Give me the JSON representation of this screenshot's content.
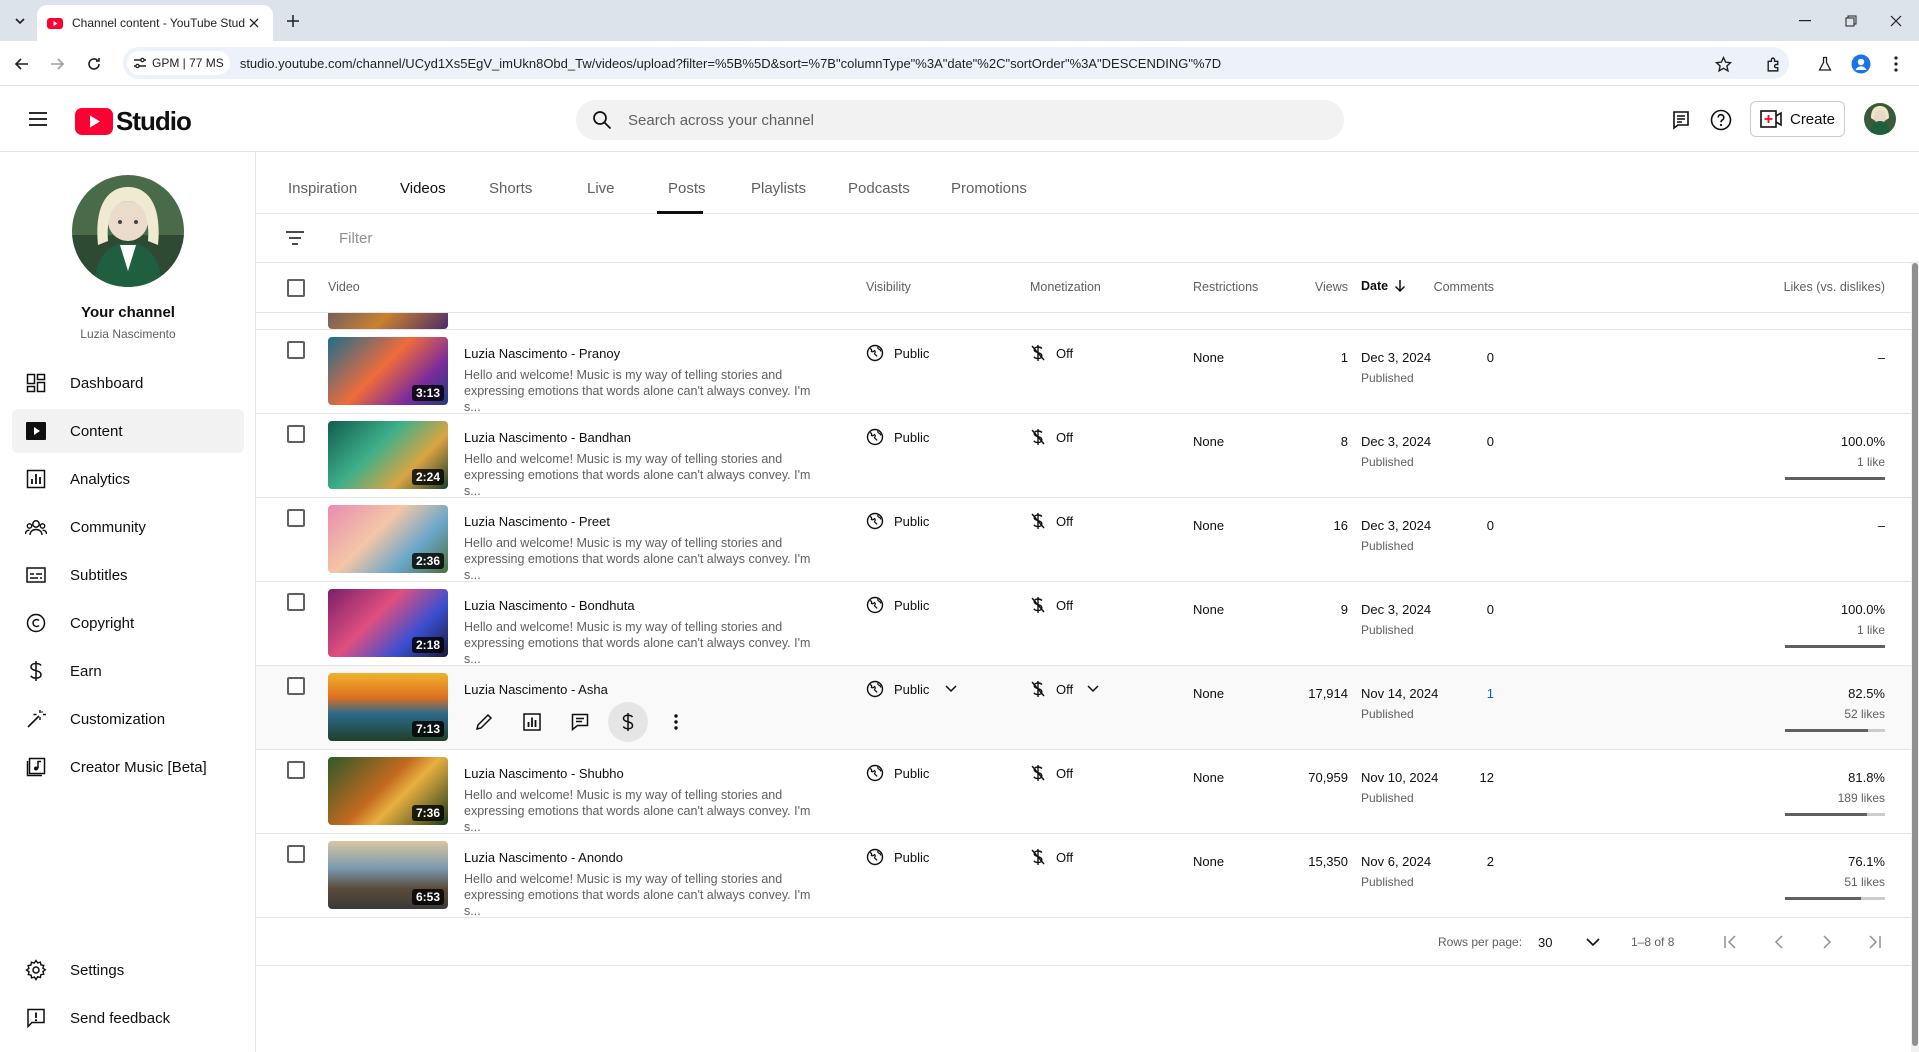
{
  "browser": {
    "tab_title": "Channel content - YouTube Studio",
    "gpm_label": "GPM | 77 MS",
    "url": "studio.youtube.com/channel/UCyd1Xs5EgV_imUkn8Obd_Tw/videos/upload?filter=%5B%5D&sort=%7B\"columnType\"%3A\"date\"%2C\"sortOrder\"%3A\"DESCENDING\"%7D"
  },
  "header": {
    "logo_text": "Studio",
    "search_placeholder": "Search across your channel",
    "create_label": "Create"
  },
  "channel": {
    "title": "Your channel",
    "name": "Luzia Nascimento"
  },
  "sidebar": {
    "items": [
      {
        "label": "Dashboard",
        "icon": "dashboard-icon"
      },
      {
        "label": "Content",
        "icon": "content-icon"
      },
      {
        "label": "Analytics",
        "icon": "analytics-icon"
      },
      {
        "label": "Community",
        "icon": "community-icon"
      },
      {
        "label": "Subtitles",
        "icon": "subtitles-icon"
      },
      {
        "label": "Copyright",
        "icon": "copyright-icon"
      },
      {
        "label": "Earn",
        "icon": "earn-icon"
      },
      {
        "label": "Customization",
        "icon": "customization-icon"
      },
      {
        "label": "Creator Music [Beta]",
        "icon": "creator-music-icon"
      }
    ],
    "settings_label": "Settings",
    "feedback_label": "Send feedback"
  },
  "tabs": [
    "Inspiration",
    "Videos",
    "Shorts",
    "Live",
    "Posts",
    "Playlists",
    "Podcasts",
    "Promotions"
  ],
  "active_tab": "Videos",
  "filter_placeholder": "Filter",
  "columns": {
    "video": "Video",
    "visibility": "Visibility",
    "monetization": "Monetization",
    "restrictions": "Restrictions",
    "date": "Date",
    "views": "Views",
    "comments": "Comments",
    "likes": "Likes (vs. dislikes)"
  },
  "rows": [
    {
      "title": "Luzia Nascimento - Pranoy",
      "duration": "3:13",
      "desc": "Hello and welcome! Music is my way of telling stories and expressing emotions that words alone can't always convey. I'm s...",
      "visibility": "Public",
      "monetization": "Off",
      "restrictions": "None",
      "date": "Dec 3, 2024",
      "status": "Published",
      "views": "1",
      "comments": "0",
      "likes_pct": "–",
      "likes_count": "",
      "likes_ratio": null
    },
    {
      "title": "Luzia Nascimento - Bandhan",
      "duration": "2:24",
      "desc": "Hello and welcome! Music is my way of telling stories and expressing emotions that words alone can't always convey. I'm s...",
      "visibility": "Public",
      "monetization": "Off",
      "restrictions": "None",
      "date": "Dec 3, 2024",
      "status": "Published",
      "views": "8",
      "comments": "0",
      "likes_pct": "100.0%",
      "likes_count": "1 like",
      "likes_ratio": 1.0
    },
    {
      "title": "Luzia Nascimento - Preet",
      "duration": "2:36",
      "desc": "Hello and welcome! Music is my way of telling stories and expressing emotions that words alone can't always convey. I'm s...",
      "visibility": "Public",
      "monetization": "Off",
      "restrictions": "None",
      "date": "Dec 3, 2024",
      "status": "Published",
      "views": "16",
      "comments": "0",
      "likes_pct": "–",
      "likes_count": "",
      "likes_ratio": null
    },
    {
      "title": "Luzia Nascimento - Bondhuta",
      "duration": "2:18",
      "desc": "Hello and welcome! Music is my way of telling stories and expressing emotions that words alone can't always convey. I'm s...",
      "visibility": "Public",
      "monetization": "Off",
      "restrictions": "None",
      "date": "Dec 3, 2024",
      "status": "Published",
      "views": "9",
      "comments": "0",
      "likes_pct": "100.0%",
      "likes_count": "1 like",
      "likes_ratio": 1.0
    },
    {
      "title": "Luzia Nascimento - Asha",
      "duration": "7:13",
      "desc": "",
      "visibility": "Public",
      "monetization": "Off",
      "restrictions": "None",
      "date": "Nov 14, 2024",
      "status": "Published",
      "views": "17,914",
      "comments": "1",
      "likes_pct": "82.5%",
      "likes_count": "52 likes",
      "likes_ratio": 0.825,
      "hover": true
    },
    {
      "title": "Luzia Nascimento - Shubho",
      "duration": "7:36",
      "desc": "Hello and welcome! Music is my way of telling stories and expressing emotions that words alone can't always convey. I'm s...",
      "visibility": "Public",
      "monetization": "Off",
      "restrictions": "None",
      "date": "Nov 10, 2024",
      "status": "Published",
      "views": "70,959",
      "comments": "12",
      "likes_pct": "81.8%",
      "likes_count": "189 likes",
      "likes_ratio": 0.818
    },
    {
      "title": "Luzia Nascimento - Anondo",
      "duration": "6:53",
      "desc": "Hello and welcome! Music is my way of telling stories and expressing emotions that words alone can't always convey. I'm s...",
      "visibility": "Public",
      "monetization": "Off",
      "restrictions": "None",
      "date": "Nov 6, 2024",
      "status": "Published",
      "views": "15,350",
      "comments": "2",
      "likes_pct": "76.1%",
      "likes_count": "51 likes",
      "likes_ratio": 0.761
    }
  ],
  "pagination": {
    "rows_label": "Rows per page:",
    "rows_value": "30",
    "range": "1–8 of 8"
  },
  "colors": {
    "accent": "#065fd4",
    "brand_red": "#ff0033"
  }
}
